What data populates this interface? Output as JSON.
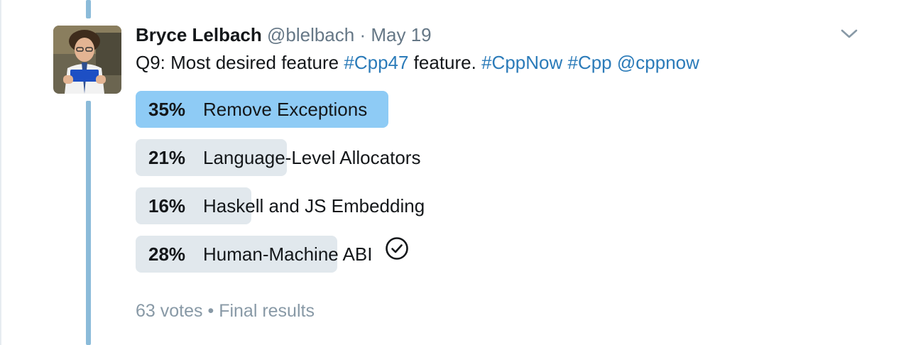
{
  "tweet": {
    "author_name": "Bryce Lelbach",
    "handle": "@blelbach",
    "separator": "·",
    "date": "May 19",
    "text_parts": [
      {
        "text": "Q9: Most desired feature ",
        "type": "plain"
      },
      {
        "text": "#Cpp47",
        "type": "hashtag"
      },
      {
        "text": " feature. ",
        "type": "plain"
      },
      {
        "text": "#CppNow",
        "type": "hashtag"
      },
      {
        "text": " ",
        "type": "plain"
      },
      {
        "text": "#Cpp",
        "type": "hashtag"
      },
      {
        "text": " ",
        "type": "plain"
      },
      {
        "text": "@cppnow",
        "type": "mention"
      }
    ]
  },
  "poll": {
    "options": [
      {
        "percent_label": "35%",
        "percent": 35,
        "label": "Remove Exceptions",
        "winner": true,
        "selected": false
      },
      {
        "percent_label": "21%",
        "percent": 21,
        "label": "Language-Level Allocators",
        "winner": false,
        "selected": false
      },
      {
        "percent_label": "16%",
        "percent": 16,
        "label": "Haskell and JS Embedding",
        "winner": false,
        "selected": false
      },
      {
        "percent_label": "28%",
        "percent": 28,
        "label": "Human-Machine ABI",
        "winner": false,
        "selected": true
      }
    ],
    "votes": "63 votes",
    "footer_separator": "•",
    "status": "Final results"
  },
  "icons": {
    "menu": "chevron-down-icon",
    "selected": "check-circle-icon"
  },
  "colors": {
    "thread_line": "#8bbbd9",
    "winner_bar": "#8ecbf5",
    "bar": "#e1e8ed",
    "link": "#2b7bb9",
    "muted": "#657786"
  }
}
